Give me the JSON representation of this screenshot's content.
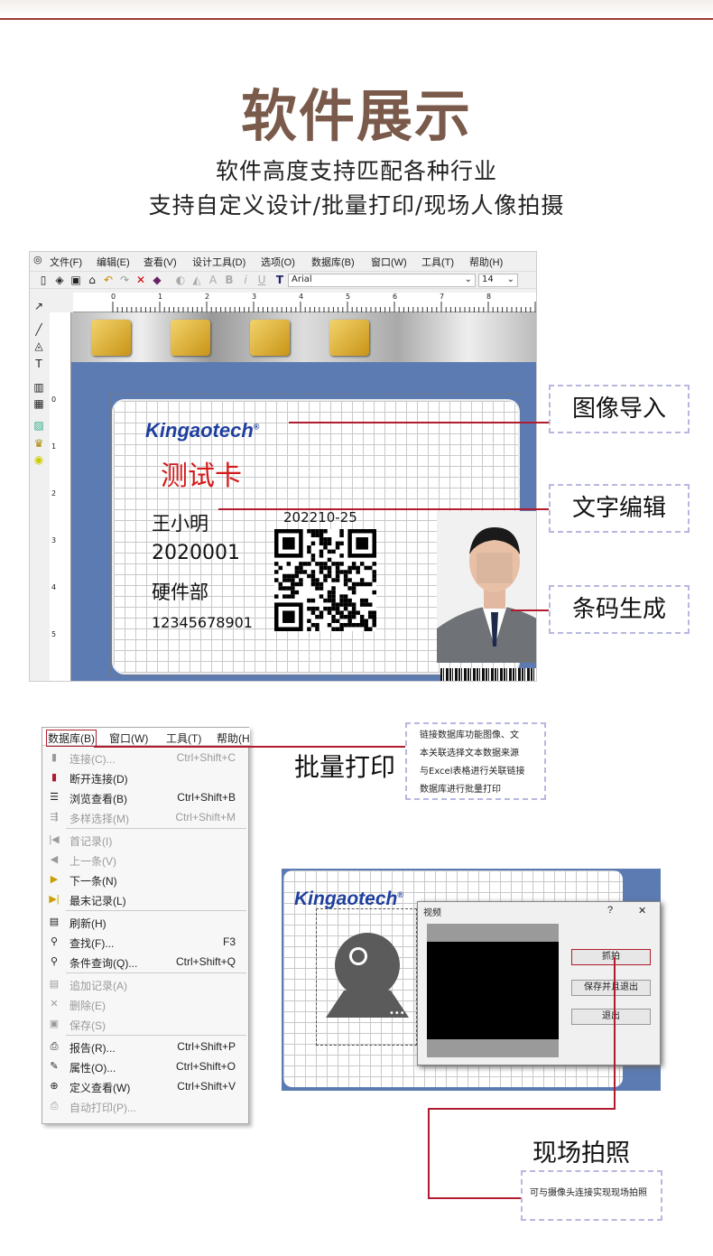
{
  "hero": {
    "title": "软件展示",
    "line1": "软件高度支持匹配各种行业",
    "line2": "支持自定义设计/批量打印/现场人像拍摄"
  },
  "app": {
    "menu": [
      "文件(F)",
      "编辑(E)",
      "查看(V)",
      "设计工具(D)",
      "选项(O)",
      "数据库(B)",
      "窗口(W)",
      "工具(T)",
      "帮助(H)"
    ],
    "font_name": "Arial",
    "font_size": "14",
    "ruler_marks": [
      "0",
      "1",
      "2",
      "3",
      "4",
      "5",
      "6",
      "7",
      "8"
    ],
    "vruler_marks": [
      "0",
      "1",
      "2",
      "3",
      "4",
      "5"
    ]
  },
  "card": {
    "logo": "Kingaotech",
    "logo_mark": "®",
    "title": "测试卡",
    "name": "王小明",
    "id": "2020001",
    "dept": "硬件部",
    "phone": "12345678901",
    "date": "202210-25"
  },
  "callouts": {
    "image_import": "图像导入",
    "text_edit": "文字编辑",
    "barcode_gen": "条码生成"
  },
  "db_menu": {
    "bar": [
      "数据库(B)",
      "窗口(W)",
      "工具(T)",
      "帮助(H"
    ],
    "items": [
      {
        "label": "连接(C)...",
        "shortcut": "Ctrl+Shift+C",
        "enabled": false
      },
      {
        "label": "断开连接(D)",
        "shortcut": "",
        "enabled": true
      },
      {
        "label": "浏览查看(B)",
        "shortcut": "Ctrl+Shift+B",
        "enabled": true
      },
      {
        "label": "多样选择(M)",
        "shortcut": "Ctrl+Shift+M",
        "enabled": false
      },
      {
        "label": "首记录(I)",
        "shortcut": "",
        "enabled": false
      },
      {
        "label": "上一条(V)",
        "shortcut": "",
        "enabled": false
      },
      {
        "label": "下一条(N)",
        "shortcut": "",
        "enabled": true
      },
      {
        "label": "最末记录(L)",
        "shortcut": "",
        "enabled": true
      },
      {
        "label": "刷新(H)",
        "shortcut": "",
        "enabled": true
      },
      {
        "label": "查找(F)...",
        "shortcut": "F3",
        "enabled": true
      },
      {
        "label": "条件查询(Q)...",
        "shortcut": "Ctrl+Shift+Q",
        "enabled": true
      },
      {
        "label": "追加记录(A)",
        "shortcut": "",
        "enabled": false
      },
      {
        "label": "删除(E)",
        "shortcut": "",
        "enabled": false
      },
      {
        "label": "保存(S)",
        "shortcut": "",
        "enabled": false
      },
      {
        "label": "报告(R)...",
        "shortcut": "Ctrl+Shift+P",
        "enabled": true
      },
      {
        "label": "属性(O)...",
        "shortcut": "Ctrl+Shift+O",
        "enabled": true
      },
      {
        "label": "定义查看(W)",
        "shortcut": "Ctrl+Shift+V",
        "enabled": true
      },
      {
        "label": "自动打印(P)...",
        "shortcut": "",
        "enabled": false
      }
    ]
  },
  "batch": {
    "label": "批量打印",
    "note": [
      "链接数据库功能图像、文",
      "本关联选择文本数据来源",
      "与Excel表格进行关联链接",
      "数据库进行批量打印"
    ]
  },
  "video": {
    "title": "视频",
    "help": "?",
    "close": "✕",
    "capture": "抓拍",
    "save_exit": "保存并且退出",
    "exit": "退出"
  },
  "live": {
    "label": "现场拍照",
    "note": "可与摄像头连接实现现场拍照"
  }
}
